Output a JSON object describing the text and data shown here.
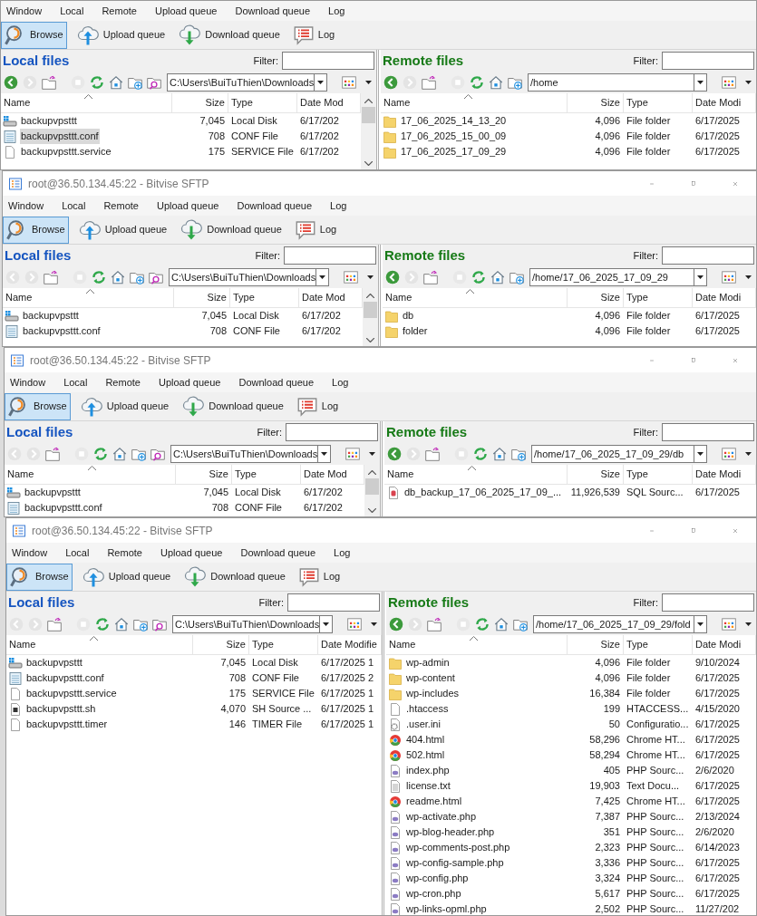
{
  "windows": [
    {
      "menu": [
        "Window",
        "Local",
        "Remote",
        "Upload queue",
        "Download queue",
        "Log"
      ],
      "toolbar": [
        {
          "label": "Browse",
          "kind": "browse",
          "selected": true
        },
        {
          "label": "Upload queue",
          "kind": "upload",
          "selected": false
        },
        {
          "label": "Download queue",
          "kind": "download",
          "selected": false
        },
        {
          "label": "Log",
          "kind": "log",
          "selected": false
        }
      ],
      "local": {
        "title": "Local files",
        "filter_label": "Filter:",
        "back_enabled": true,
        "path": "C:\\Users\\BuiTuThien\\Downloads",
        "columns": [
          "Name",
          "Size",
          "Type",
          "Date Mod"
        ],
        "rows": [
          {
            "name": "backupvpsttt",
            "size": "7,045",
            "type": "Local Disk",
            "date": "6/17/202",
            "kind": "drive",
            "selected": false
          },
          {
            "name": "backupvpsttt.conf",
            "size": "708",
            "type": "CONF File",
            "date": "6/17/202",
            "kind": "conf",
            "selected": true
          },
          {
            "name": "backupvpsttt.service",
            "size": "175",
            "type": "SERVICE File",
            "date": "6/17/202",
            "kind": "file",
            "selected": false
          }
        ]
      },
      "remote": {
        "title": "Remote files",
        "filter_label": "Filter:",
        "back_enabled": true,
        "path": "/home",
        "columns": [
          "Name",
          "Size",
          "Type",
          "Date Modi"
        ],
        "rows": [
          {
            "name": "17_06_2025_14_13_20",
            "size": "4,096",
            "type": "File folder",
            "date": "6/17/2025",
            "kind": "folder",
            "selected": false
          },
          {
            "name": "17_06_2025_15_00_09",
            "size": "4,096",
            "type": "File folder",
            "date": "6/17/2025",
            "kind": "folder",
            "selected": false
          },
          {
            "name": "17_06_2025_17_09_29",
            "size": "4,096",
            "type": "File folder",
            "date": "6/17/2025",
            "kind": "folder",
            "selected": false
          }
        ]
      }
    },
    {
      "title": "root@36.50.134.45:22 - Bitvise SFTP",
      "menu": [
        "Window",
        "Local",
        "Remote",
        "Upload queue",
        "Download queue",
        "Log"
      ],
      "toolbar": [
        {
          "label": "Browse",
          "kind": "browse",
          "selected": true
        },
        {
          "label": "Upload queue",
          "kind": "upload",
          "selected": false
        },
        {
          "label": "Download queue",
          "kind": "download",
          "selected": false
        },
        {
          "label": "Log",
          "kind": "log",
          "selected": false
        }
      ],
      "local": {
        "title": "Local files",
        "filter_label": "Filter:",
        "back_enabled": false,
        "path": "C:\\Users\\BuiTuThien\\Downloads",
        "columns": [
          "Name",
          "Size",
          "Type",
          "Date Mod"
        ],
        "rows": [
          {
            "name": "backupvpsttt",
            "size": "7,045",
            "type": "Local Disk",
            "date": "6/17/202",
            "kind": "drive",
            "selected": false
          },
          {
            "name": "backupvpsttt.conf",
            "size": "708",
            "type": "CONF File",
            "date": "6/17/202",
            "kind": "conf",
            "selected": false
          }
        ]
      },
      "remote": {
        "title": "Remote files",
        "filter_label": "Filter:",
        "back_enabled": true,
        "path": "/home/17_06_2025_17_09_29",
        "columns": [
          "Name",
          "Size",
          "Type",
          "Date Modi"
        ],
        "rows": [
          {
            "name": "db",
            "size": "4,096",
            "type": "File folder",
            "date": "6/17/2025",
            "kind": "folder",
            "selected": false
          },
          {
            "name": "folder",
            "size": "4,096",
            "type": "File folder",
            "date": "6/17/2025",
            "kind": "folder",
            "selected": false
          }
        ]
      }
    },
    {
      "title": "root@36.50.134.45:22 - Bitvise SFTP",
      "menu": [
        "Window",
        "Local",
        "Remote",
        "Upload queue",
        "Download queue",
        "Log"
      ],
      "toolbar": [
        {
          "label": "Browse",
          "kind": "browse",
          "selected": true
        },
        {
          "label": "Upload queue",
          "kind": "upload",
          "selected": false
        },
        {
          "label": "Download queue",
          "kind": "download",
          "selected": false
        },
        {
          "label": "Log",
          "kind": "log",
          "selected": false
        }
      ],
      "local": {
        "title": "Local files",
        "filter_label": "Filter:",
        "back_enabled": false,
        "path": "C:\\Users\\BuiTuThien\\Downloads",
        "columns": [
          "Name",
          "Size",
          "Type",
          "Date Mod"
        ],
        "rows": [
          {
            "name": "backupvpsttt",
            "size": "7,045",
            "type": "Local Disk",
            "date": "6/17/202",
            "kind": "drive",
            "selected": false
          },
          {
            "name": "backupvpsttt.conf",
            "size": "708",
            "type": "CONF File",
            "date": "6/17/202",
            "kind": "conf",
            "selected": false
          }
        ]
      },
      "remote": {
        "title": "Remote files",
        "filter_label": "Filter:",
        "back_enabled": true,
        "path": "/home/17_06_2025_17_09_29/db",
        "columns": [
          "Name",
          "Size",
          "Type",
          "Date Modi"
        ],
        "rows": [
          {
            "name": "db_backup_17_06_2025_17_09_...",
            "size": "11,926,539",
            "type": "SQL Sourc...",
            "date": "6/17/2025",
            "kind": "sql",
            "selected": false
          }
        ]
      }
    },
    {
      "title": "root@36.50.134.45:22 - Bitvise SFTP",
      "menu": [
        "Window",
        "Local",
        "Remote",
        "Upload queue",
        "Download queue",
        "Log"
      ],
      "toolbar": [
        {
          "label": "Browse",
          "kind": "browse",
          "selected": true
        },
        {
          "label": "Upload queue",
          "kind": "upload",
          "selected": false
        },
        {
          "label": "Download queue",
          "kind": "download",
          "selected": false
        },
        {
          "label": "Log",
          "kind": "log",
          "selected": false
        }
      ],
      "local": {
        "title": "Local files",
        "filter_label": "Filter:",
        "back_enabled": false,
        "path": "C:\\Users\\BuiTuThien\\Downloads",
        "columns": [
          "Name",
          "Size",
          "Type",
          "Date Modifie"
        ],
        "rows": [
          {
            "name": "backupvpsttt",
            "size": "7,045",
            "type": "Local Disk",
            "date": "6/17/2025 1",
            "kind": "drive",
            "selected": false
          },
          {
            "name": "backupvpsttt.conf",
            "size": "708",
            "type": "CONF File",
            "date": "6/17/2025 2",
            "kind": "conf",
            "selected": false
          },
          {
            "name": "backupvpsttt.service",
            "size": "175",
            "type": "SERVICE File",
            "date": "6/17/2025 1",
            "kind": "file",
            "selected": false
          },
          {
            "name": "backupvpsttt.sh",
            "size": "4,070",
            "type": "SH Source ...",
            "date": "6/17/2025 1",
            "kind": "sh",
            "selected": false
          },
          {
            "name": "backupvpsttt.timer",
            "size": "146",
            "type": "TIMER File",
            "date": "6/17/2025 1",
            "kind": "file",
            "selected": false
          }
        ]
      },
      "remote": {
        "title": "Remote files",
        "filter_label": "Filter:",
        "back_enabled": true,
        "path": "/home/17_06_2025_17_09_29/fold",
        "columns": [
          "Name",
          "Size",
          "Type",
          "Date Modi"
        ],
        "rows": [
          {
            "name": "wp-admin",
            "size": "4,096",
            "type": "File folder",
            "date": "9/10/2024",
            "kind": "folder",
            "selected": false
          },
          {
            "name": "wp-content",
            "size": "4,096",
            "type": "File folder",
            "date": "6/17/2025",
            "kind": "folder",
            "selected": false
          },
          {
            "name": "wp-includes",
            "size": "16,384",
            "type": "File folder",
            "date": "6/17/2025",
            "kind": "folder",
            "selected": false
          },
          {
            "name": ".htaccess",
            "size": "199",
            "type": "HTACCESS...",
            "date": "4/15/2020",
            "kind": "file",
            "selected": false
          },
          {
            "name": ".user.ini",
            "size": "50",
            "type": "Configuratio...",
            "date": "6/17/2025",
            "kind": "settings",
            "selected": false
          },
          {
            "name": "404.html",
            "size": "58,296",
            "type": "Chrome HT...",
            "date": "6/17/2025",
            "kind": "chrome",
            "selected": false
          },
          {
            "name": "502.html",
            "size": "58,294",
            "type": "Chrome HT...",
            "date": "6/17/2025",
            "kind": "chrome",
            "selected": false
          },
          {
            "name": "index.php",
            "size": "405",
            "type": "PHP Sourc...",
            "date": "2/6/2020",
            "kind": "php",
            "selected": false
          },
          {
            "name": "license.txt",
            "size": "19,903",
            "type": "Text Docu...",
            "date": "6/17/2025",
            "kind": "text",
            "selected": false
          },
          {
            "name": "readme.html",
            "size": "7,425",
            "type": "Chrome HT...",
            "date": "6/17/2025",
            "kind": "chrome",
            "selected": false
          },
          {
            "name": "wp-activate.php",
            "size": "7,387",
            "type": "PHP Sourc...",
            "date": "2/13/2024",
            "kind": "php",
            "selected": false
          },
          {
            "name": "wp-blog-header.php",
            "size": "351",
            "type": "PHP Sourc...",
            "date": "2/6/2020",
            "kind": "php",
            "selected": false
          },
          {
            "name": "wp-comments-post.php",
            "size": "2,323",
            "type": "PHP Sourc...",
            "date": "6/14/2023",
            "kind": "php",
            "selected": false
          },
          {
            "name": "wp-config-sample.php",
            "size": "3,336",
            "type": "PHP Sourc...",
            "date": "6/17/2025",
            "kind": "php",
            "selected": false
          },
          {
            "name": "wp-config.php",
            "size": "3,324",
            "type": "PHP Sourc...",
            "date": "6/17/2025",
            "kind": "php",
            "selected": false
          },
          {
            "name": "wp-cron.php",
            "size": "5,617",
            "type": "PHP Sourc...",
            "date": "6/17/2025",
            "kind": "php",
            "selected": false
          },
          {
            "name": "wp-links-opml.php",
            "size": "2,502",
            "type": "PHP Sourc...",
            "date": "11/27/202",
            "kind": "php",
            "selected": false
          }
        ]
      }
    }
  ]
}
